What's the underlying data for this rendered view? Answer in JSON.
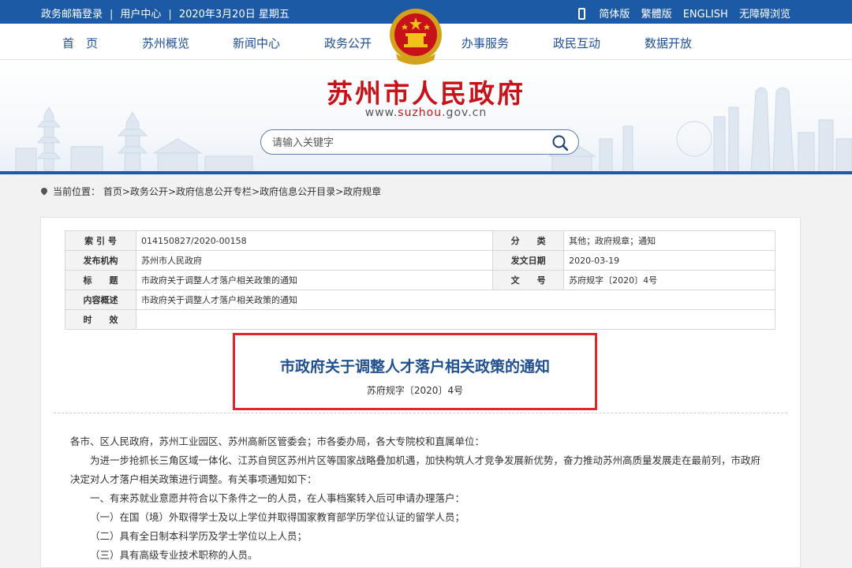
{
  "topbar": {
    "mail_login": "政务邮箱登录",
    "user_center": "用户中心",
    "date": "2020年3月20日 星期五",
    "lang_simplified": "简体版",
    "lang_traditional": "繁體版",
    "lang_english": "ENGLISH",
    "accessibility": "无障碍浏览"
  },
  "nav": {
    "items": [
      "首　页",
      "苏州概览",
      "新闻中心",
      "政务公开",
      "办事服务",
      "政民互动",
      "数据开放"
    ]
  },
  "banner": {
    "site_title": "苏州市人民政府",
    "url_prefix": "www.",
    "url_domain": "suzhou",
    "url_suffix": ".gov.cn"
  },
  "search": {
    "placeholder": "请输入关键字"
  },
  "breadcrumb": {
    "prefix": "当前位置：",
    "items": [
      "首页",
      "政务公开",
      "政府信息公开专栏",
      "政府信息公开目录",
      "政府规章"
    ],
    "separator": ">"
  },
  "meta": {
    "index_label": "索 引 号",
    "index_value": "014150827/2020-00158",
    "category_label": "分　　类",
    "category_value": "其他；政府规章；通知",
    "issuer_label": "发布机构",
    "issuer_value": "苏州市人民政府",
    "date_label": "发文日期",
    "date_value": "2020-03-19",
    "title_label": "标　　题",
    "title_value": "市政府关于调整人才落户相关政策的通知",
    "docno_label": "文　　号",
    "docno_value": "苏府规字〔2020〕4号",
    "summary_label": "内容概述",
    "summary_value": "市政府关于调整人才落户相关政策的通知",
    "validity_label": "时　　效",
    "validity_value": ""
  },
  "document": {
    "title": "市政府关于调整人才落户相关政策的通知",
    "number": "苏府规字〔2020〕4号",
    "paragraphs": [
      "各市、区人民政府，苏州工业园区、苏州高新区管委会；市各委办局，各大专院校和直属单位：",
      "为进一步抢抓长三角区域一体化、江苏自贸区苏州片区等国家战略叠加机遇，加快构筑人才竞争发展新优势，奋力推动苏州高质量发展走在最前列，市政府决定对人才落户相关政策进行调整。有关事项通知如下：",
      "一、有来苏就业意愿并符合以下条件之一的人员，在人事档案转入后可申请办理落户：",
      "（一）在国（境）外取得学士及以上学位并取得国家教育部学历学位认证的留学人员；",
      "（二）具有全日制本科学历及学士学位以上人员；",
      "（三）具有高级专业技术职称的人员。"
    ]
  },
  "colors": {
    "topbar_blue": "#1d5aa6",
    "title_red": "#c8121a",
    "highlight_border": "#e0262d",
    "doc_title_blue": "#1f4f8f"
  }
}
